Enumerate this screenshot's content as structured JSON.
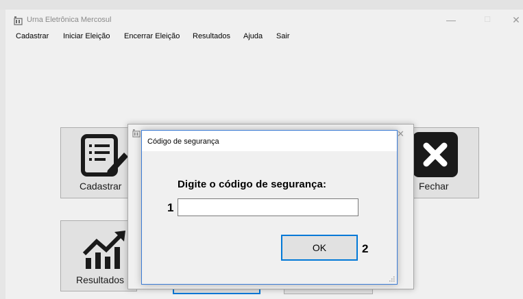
{
  "window": {
    "title": "Urna Eletrônica Mercosul",
    "minimize_glyph": "—",
    "maximize_glyph": "☐",
    "close_glyph": "✕"
  },
  "menu": {
    "items": [
      "Cadastrar",
      "Iniciar Eleição",
      "Encerrar Eleição",
      "Resultados",
      "Ajuda",
      "Sair"
    ]
  },
  "main_buttons": {
    "cadastrar": {
      "label": "Cadastrar",
      "icon": "document-edit-icon"
    },
    "fechar": {
      "label": "Fechar",
      "icon": "close-x-icon"
    },
    "resultados": {
      "label": "Resultados",
      "icon": "chart-trend-icon"
    }
  },
  "dialog": {
    "title": "Código de segurança",
    "prompt": "Digite o código de segurança:",
    "input_value": "",
    "ok_label": "OK"
  },
  "annotations": {
    "marker_1": "1",
    "marker_2": "2"
  },
  "colors": {
    "focus_border": "#0078d7",
    "window_bg": "#f0f0f0",
    "button_bg": "#e1e1e1"
  }
}
